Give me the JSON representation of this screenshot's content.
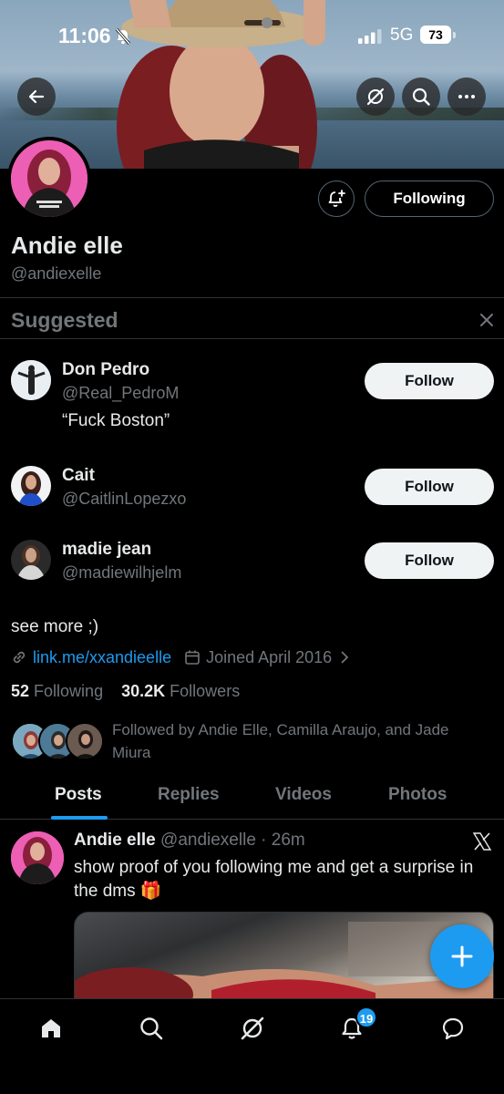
{
  "status_bar": {
    "time": "11:06",
    "network": "5G",
    "battery": "73"
  },
  "profile": {
    "name": "Andie elle",
    "handle": "@andiexelle",
    "following_button": "Following",
    "bio": "see more ;)",
    "link": "link.me/xxandieelle",
    "joined": "Joined April 2016",
    "following_count": "52",
    "following_label": "Following",
    "followers_count": "30.2K",
    "followers_label": "Followers",
    "followed_by": "Followed by Andie Elle, Camilla Araujo, and Jade Miura"
  },
  "suggested": {
    "title": "Suggested",
    "items": [
      {
        "name": "Don Pedro",
        "handle": "@Real_PedroM",
        "bio": "“Fuck Boston”",
        "button": "Follow"
      },
      {
        "name": "Cait",
        "handle": "@CaitlinLopezxo",
        "button": "Follow"
      },
      {
        "name": "madie jean",
        "handle": "@madiewilhjelm",
        "button": "Follow"
      }
    ]
  },
  "tabs": [
    "Posts",
    "Replies",
    "Videos",
    "Photos"
  ],
  "post": {
    "name": "Andie elle",
    "handle_time": "@andiexelle · 26m",
    "text": "show proof of you following me and get a surprise in the dms 🎁"
  },
  "nav": {
    "notifications_badge": "19"
  },
  "colors": {
    "accent": "#1d9bf0",
    "background": "#000000",
    "muted": "#71767b",
    "avatar_pink": "#ec5fb4"
  },
  "icons": [
    "back-arrow-icon",
    "grok-icon",
    "search-icon",
    "more-icon",
    "bell-plus-icon",
    "close-icon",
    "link-icon",
    "calendar-icon",
    "chevron-right-icon",
    "x-logo-icon",
    "plus-icon",
    "home-icon",
    "bell-icon",
    "message-icon"
  ]
}
